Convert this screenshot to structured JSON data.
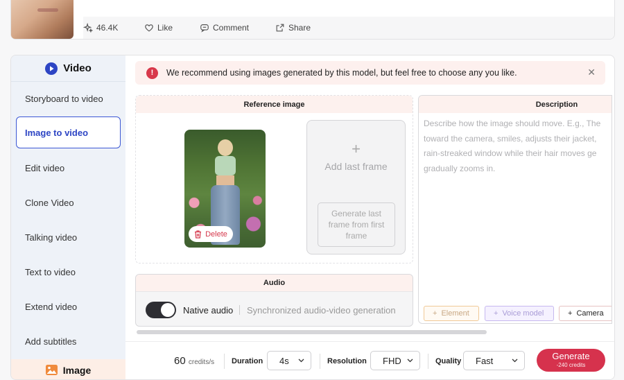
{
  "post": {
    "stats": [
      {
        "icon": "sparkle-icon",
        "label": "46.4K"
      },
      {
        "icon": "heart-icon",
        "label": "Like"
      },
      {
        "icon": "comment-icon",
        "label": "Comment"
      },
      {
        "icon": "share-icon",
        "label": "Share"
      }
    ]
  },
  "sidebar": {
    "header": "Video",
    "items": [
      {
        "label": "Storyboard to video"
      },
      {
        "label": "Image to video"
      },
      {
        "label": "Edit video"
      },
      {
        "label": "Clone Video"
      },
      {
        "label": "Talking video"
      },
      {
        "label": "Text to video"
      },
      {
        "label": "Extend video"
      },
      {
        "label": "Add subtitles"
      }
    ],
    "image_section": "Image"
  },
  "notice": {
    "text": "We recommend using images generated by this model, but feel free to choose any you like."
  },
  "reference": {
    "title": "Reference image",
    "delete_label": "Delete",
    "add_last_frame": "Add last frame",
    "generate_last_frame": "Generate last frame from first frame"
  },
  "audio": {
    "title": "Audio",
    "toggle_label": "Native audio",
    "toggle_on": true,
    "description": "Synchronized audio-video generation"
  },
  "description": {
    "title": "Description",
    "placeholder_lines": [
      "Describe how the image should move. E.g., The",
      "toward the camera, smiles, adjusts their jacket,",
      "rain-streaked window while their hair moves ge",
      "gradually zooms in."
    ],
    "chips": [
      {
        "label": "Element"
      },
      {
        "label": "Voice model"
      },
      {
        "label": "Camera"
      }
    ]
  },
  "bottom": {
    "credits_value": "60",
    "credits_unit": "credits/s",
    "duration_label": "Duration",
    "duration_value": "4s",
    "resolution_label": "Resolution",
    "resolution_value": "FHD",
    "quality_label": "Quality",
    "quality_value": "Fast",
    "generate_label": "Generate",
    "generate_cost": "-240 credits"
  },
  "colors": {
    "accent_blue": "#2d45c4",
    "generate_red": "#d6324d",
    "notice_bg": "#fdf0ee"
  }
}
